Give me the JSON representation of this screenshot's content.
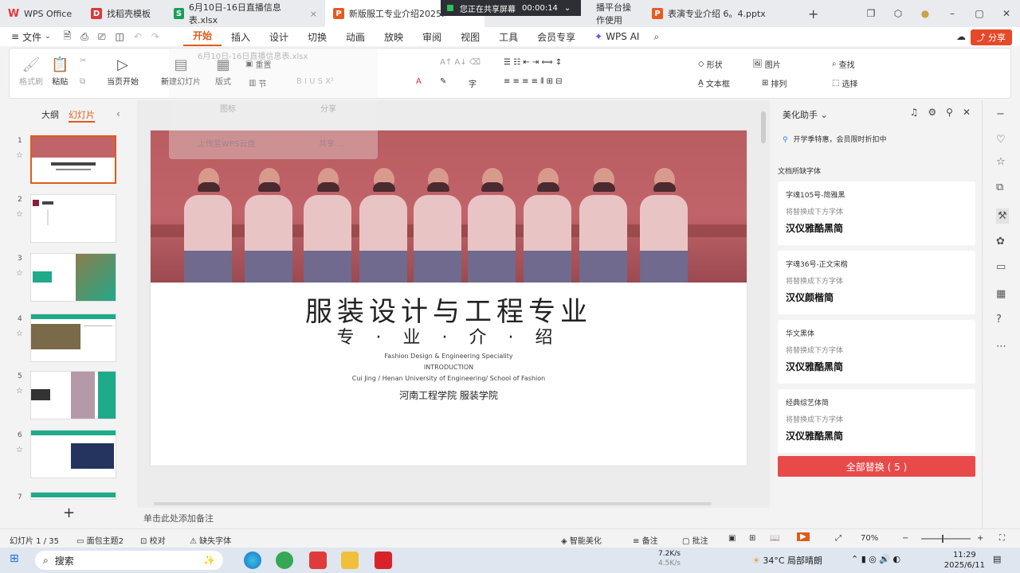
{
  "tabs": [
    {
      "label": "WPS Office",
      "icon": "wps-logo-icon",
      "active": false
    },
    {
      "label": "找稻壳模板",
      "icon": "docer-icon",
      "active": false
    },
    {
      "label": "6月10日-16日直播信息表.xlsx",
      "icon": "spreadsheet-icon",
      "active": false
    },
    {
      "label": "新版服工专业介绍2025.",
      "icon": "presentation-icon",
      "active": true
    },
    {
      "label": "播平台操作使用",
      "icon": "document-icon",
      "active": false
    },
    {
      "label": "表演专业介绍 6。4.pptx",
      "icon": "presentation-icon",
      "active": false
    }
  ],
  "share_banner": {
    "text": "您正在共享屏幕",
    "timer": "00:00:14"
  },
  "menu": {
    "file": "文件",
    "items": [
      "开始",
      "插入",
      "设计",
      "切换",
      "动画",
      "放映",
      "审阅",
      "视图",
      "工具",
      "会员专享",
      "WPS AI"
    ],
    "active": "开始",
    "share": "分享"
  },
  "ribbon": {
    "format_painter": "格式刷",
    "paste": "粘贴",
    "play_from_current": "当页开始",
    "new_slide": "新建幻灯片",
    "layout": "版式",
    "section": "节",
    "reset": "重置",
    "shape": "形状",
    "picture": "图片",
    "find": "查找",
    "textbox": "文本框",
    "arrange": "排列",
    "select": "选择"
  },
  "ghost_menu": {
    "line1": "6月10日-16日直播信息表.xlsx",
    "line2": "图标",
    "line3": "分享",
    "line4": "上传至WPS云盘",
    "line5": "共享 ..."
  },
  "left_panel": {
    "tab_outline": "大纲",
    "tab_slides": "幻灯片",
    "slide_numbers": [
      "1",
      "2",
      "3",
      "4",
      "5",
      "6",
      "7"
    ]
  },
  "slide": {
    "title": "服装设计与工程专业",
    "subtitle": "专 · 业 · 介 · 绍",
    "en_line1": "Fashion Design & Engineering Speciality",
    "en_line2": "INTRODUCTION",
    "en_line3": "Cui Jing /  Henan University of Engineering/ School of Fashion",
    "school": "河南工程学院 服装学院"
  },
  "notes_placeholder": "单击此处添加备注",
  "right_panel": {
    "title": "美化助手",
    "promo": "开学季特惠，会员限时折扣中",
    "section_title": "文档所缺字体",
    "fonts": [
      {
        "name": "字魂105号-简雅黑",
        "hint": "将替换成下方字体",
        "replacement": "汉仪雅酷黑简"
      },
      {
        "name": "字魂36号-正文宋楷",
        "hint": "将替换成下方字体",
        "replacement": "汉仪颜楷简"
      },
      {
        "name": "华文黑体",
        "hint": "将替换成下方字体",
        "replacement": "汉仪雅酷黑简"
      },
      {
        "name": "经典综艺体简",
        "hint": "将替换成下方字体",
        "replacement": "汉仪雅酷黑简"
      }
    ],
    "replace_all": "全部替换 ( 5 )"
  },
  "status": {
    "slide_count": "幻灯片 1 / 35",
    "theme": "面包主题2",
    "proofread": "校对",
    "missing_font": "缺失字体",
    "smart_beautify": "智能美化",
    "notes": "备注",
    "comments": "批注",
    "zoom": "70%"
  },
  "taskbar": {
    "search": "搜索",
    "net_up": "7.2K/s",
    "net_down": "4.5K/s",
    "weather": "34°C 局部晴朗",
    "time": "11:29",
    "date": "2025/6/11"
  },
  "colors": {
    "accent": "#e25c18",
    "replace_button": "#e84a4a",
    "teal": "#1faa8a",
    "photo_tint": "#c1646a"
  }
}
